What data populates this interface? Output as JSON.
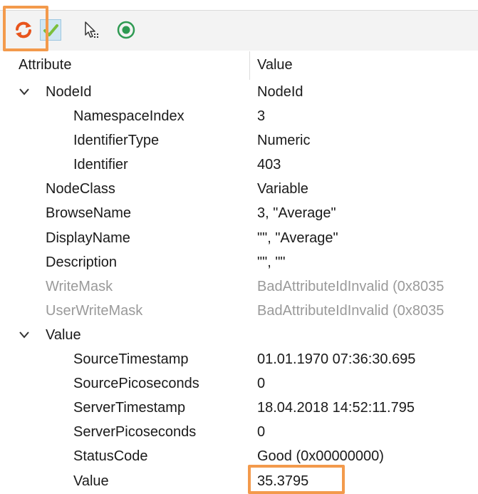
{
  "toolbar": {
    "buttons": [
      {
        "name": "refresh-icon"
      },
      {
        "name": "checkmark-icon"
      },
      {
        "name": "cursor-select-icon"
      },
      {
        "name": "target-icon"
      }
    ]
  },
  "table": {
    "columns": [
      "Attribute",
      "Value"
    ],
    "rows": [
      {
        "name": "NodeId",
        "value": "NodeId",
        "level": 0,
        "expander": true,
        "disabled": false
      },
      {
        "name": "NamespaceIndex",
        "value": "3",
        "level": 1,
        "expander": false,
        "disabled": false
      },
      {
        "name": "IdentifierType",
        "value": "Numeric",
        "level": 1,
        "expander": false,
        "disabled": false
      },
      {
        "name": "Identifier",
        "value": "403",
        "level": 1,
        "expander": false,
        "disabled": false
      },
      {
        "name": "NodeClass",
        "value": "Variable",
        "level": 0,
        "expander": false,
        "disabled": false
      },
      {
        "name": "BrowseName",
        "value": "3, \"Average\"",
        "level": 0,
        "expander": false,
        "disabled": false
      },
      {
        "name": "DisplayName",
        "value": "\"\", \"Average\"",
        "level": 0,
        "expander": false,
        "disabled": false
      },
      {
        "name": "Description",
        "value": "\"\", \"\"",
        "level": 0,
        "expander": false,
        "disabled": false
      },
      {
        "name": "WriteMask",
        "value": "BadAttributeIdInvalid (0x8035",
        "level": 0,
        "expander": false,
        "disabled": true
      },
      {
        "name": "UserWriteMask",
        "value": "BadAttributeIdInvalid (0x8035",
        "level": 0,
        "expander": false,
        "disabled": true
      },
      {
        "name": "Value",
        "value": "",
        "level": 0,
        "expander": true,
        "disabled": false
      },
      {
        "name": "SourceTimestamp",
        "value": "01.01.1970 07:36:30.695",
        "level": 1,
        "expander": false,
        "disabled": false
      },
      {
        "name": "SourcePicoseconds",
        "value": "0",
        "level": 1,
        "expander": false,
        "disabled": false
      },
      {
        "name": "ServerTimestamp",
        "value": "18.04.2018 14:52:11.795",
        "level": 1,
        "expander": false,
        "disabled": false
      },
      {
        "name": "ServerPicoseconds",
        "value": "0",
        "level": 1,
        "expander": false,
        "disabled": false
      },
      {
        "name": "StatusCode",
        "value": "Good (0x00000000)",
        "level": 1,
        "expander": false,
        "disabled": false
      },
      {
        "name": "Value",
        "value": "35.3795",
        "level": 1,
        "expander": false,
        "disabled": false
      }
    ]
  },
  "colors": {
    "highlight": "#f39a4c",
    "disabled_text": "#9a9a9a",
    "toolbar_bg": "#f3f3f3"
  }
}
